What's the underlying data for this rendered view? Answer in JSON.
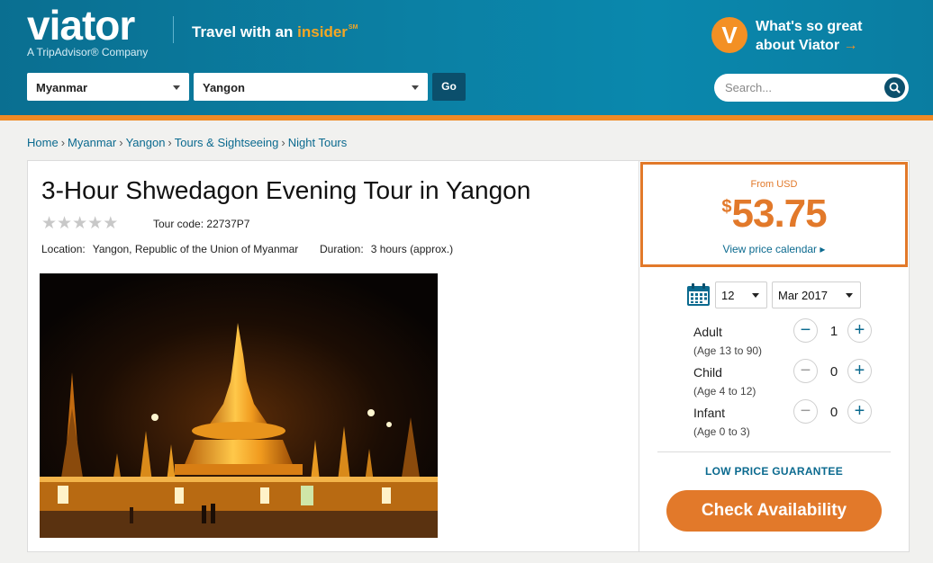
{
  "header": {
    "logo": "viator",
    "logo_sub": "A TripAdvisor® Company",
    "tagline_prefix": "Travel with an ",
    "tagline_highlight": "insider",
    "tagline_tm": "SM",
    "country_select": "Myanmar",
    "city_select": "Yangon",
    "go_label": "Go",
    "badge_letter": "V",
    "promo_line1": "What's so great",
    "promo_line2": "about Viator",
    "promo_arrow": "→",
    "search_placeholder": "Search..."
  },
  "breadcrumb": {
    "items": [
      "Home",
      "Myanmar",
      "Yangon",
      "Tours & Sightseeing",
      "Night Tours"
    ],
    "separator": "›"
  },
  "product": {
    "title": "3-Hour Shwedagon Evening Tour in Yangon",
    "rating_stars": 0,
    "rating_max": 5,
    "tour_code_label": "Tour code:",
    "tour_code": "22737P7",
    "location_label": "Location:",
    "location": "Yangon, Republic of the Union of Myanmar",
    "duration_label": "Duration:",
    "duration": "3 hours (approx.)"
  },
  "pricing": {
    "from_label": "From USD",
    "currency_symbol": "$",
    "amount": "53.75",
    "calendar_link": "View price calendar",
    "calendar_arrow": "▸"
  },
  "booking": {
    "day": "12",
    "month": "Mar 2017",
    "travelers": [
      {
        "label": "Adult",
        "age": "(Age 13 to 90)",
        "count": "1"
      },
      {
        "label": "Child",
        "age": "(Age 4 to 12)",
        "count": "0"
      },
      {
        "label": "Infant",
        "age": "(Age 0 to 3)",
        "count": "0"
      }
    ],
    "minus_symbol": "−",
    "plus_symbol": "+",
    "guarantee": "LOW PRICE GUARANTEE",
    "check_button": "Check Availability"
  },
  "colors": {
    "header_blue": "#0b80a4",
    "accent_orange": "#e2792a",
    "link_blue": "#0b6a8f",
    "dark_button": "#0b4f6c"
  },
  "icons": {
    "search": "search-icon",
    "calendar": "calendar-icon",
    "caret": "chevron-down-icon",
    "star": "star-icon"
  }
}
